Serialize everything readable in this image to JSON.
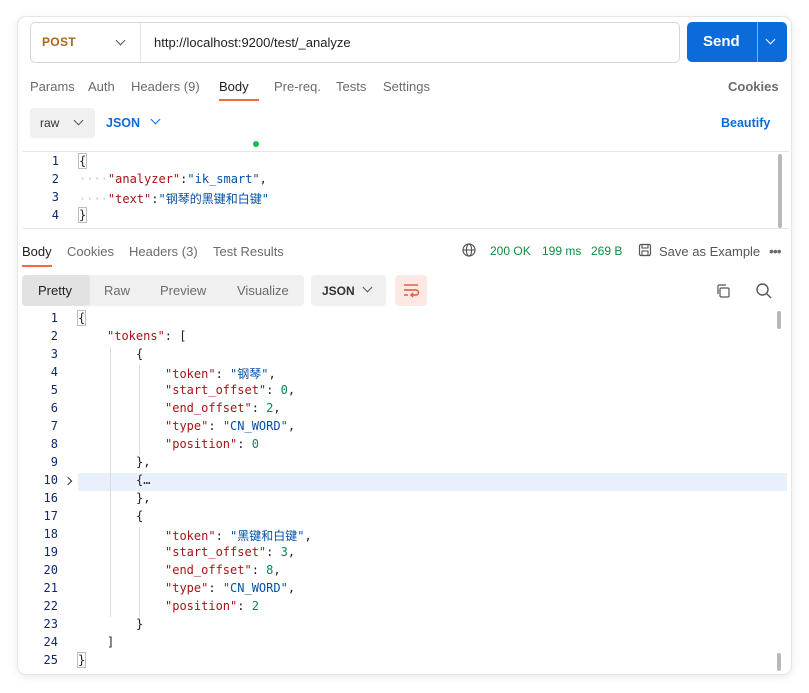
{
  "request": {
    "method": "POST",
    "url": "http://localhost:9200/test/_analyze",
    "send_label": "Send"
  },
  "request_tabs": {
    "params": "Params",
    "auth": "Auth",
    "headers": "Headers",
    "headers_count": "(9)",
    "body": "Body",
    "prereq": "Pre-req.",
    "tests": "Tests",
    "settings": "Settings",
    "cookies": "Cookies"
  },
  "body_options": {
    "mode": "raw",
    "language": "JSON",
    "beautify": "Beautify"
  },
  "request_body": {
    "line_numbers": [
      "1",
      "2",
      "3",
      "4"
    ],
    "open_brace": "{",
    "analyzer_key": "\"analyzer\"",
    "analyzer_value": "\"ik_smart\"",
    "text_key": "\"text\"",
    "text_value": "\"钢琴的黑键和白键\"",
    "close_brace": "}"
  },
  "response_tabs": {
    "body": "Body",
    "cookies": "Cookies",
    "headers": "Headers",
    "headers_count": "(3)",
    "test_results": "Test Results"
  },
  "response_status": {
    "status": "200 OK",
    "time": "199 ms",
    "size": "269 B",
    "save_example": "Save as Example",
    "more": "•••"
  },
  "response_view": {
    "modes": [
      "Pretty",
      "Raw",
      "Preview",
      "Visualize"
    ],
    "language": "JSON"
  },
  "response_body": {
    "line_numbers": [
      "1",
      "2",
      "3",
      "4",
      "5",
      "6",
      "7",
      "8",
      "9",
      "10",
      "16",
      "17",
      "18",
      "19",
      "20",
      "21",
      "22",
      "23",
      "24",
      "25"
    ],
    "lines": {
      "l1": "{",
      "l2_key": "\"tokens\"",
      "l2_rest": ": [",
      "l3": "{",
      "l4_key": "\"token\"",
      "l4_val": "\"钢琴\"",
      "l5_key": "\"start_offset\"",
      "l5_val": "0",
      "l6_key": "\"end_offset\"",
      "l6_val": "2",
      "l7_key": "\"type\"",
      "l7_val": "\"CN_WORD\"",
      "l8_key": "\"position\"",
      "l8_val": "0",
      "l9": "},",
      "l10": "{…",
      "l16": "},",
      "l17": "{",
      "l18_key": "\"token\"",
      "l18_val": "\"黑键和白键\"",
      "l19_key": "\"start_offset\"",
      "l19_val": "3",
      "l20_key": "\"end_offset\"",
      "l20_val": "8",
      "l21_key": "\"type\"",
      "l21_val": "\"CN_WORD\"",
      "l22_key": "\"position\"",
      "l22_val": "2",
      "l23": "}",
      "l24": "]",
      "l25": "}"
    }
  },
  "colors": {
    "send": "#0b6bd8",
    "accent_tab": "#f26b3a",
    "status_ok": "#0f8a3e",
    "json_key": "#a31515",
    "json_string": "#0451a5",
    "json_number": "#098658"
  }
}
